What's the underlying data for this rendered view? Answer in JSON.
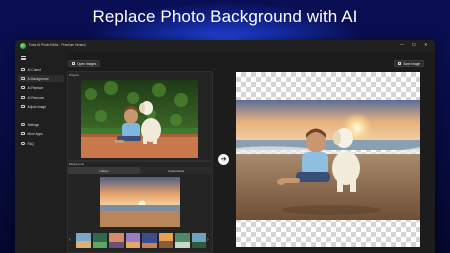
{
  "headline": "Replace Photo Background with AI",
  "window": {
    "title": "Fotor AI Photo Editor - Premium Version",
    "controls": [
      "—",
      "☐",
      "✕"
    ]
  },
  "sidebar": {
    "items": [
      {
        "label": "AI Cutout",
        "icon": "cutout-icon"
      },
      {
        "label": "AI Background",
        "icon": "background-icon"
      },
      {
        "label": "AI Replace",
        "icon": "replace-icon"
      },
      {
        "label": "AI Remover",
        "icon": "eraser-icon"
      },
      {
        "label": "Adjust Image",
        "icon": "adjust-icon"
      },
      {
        "label": "Settings",
        "icon": "gear-icon"
      },
      {
        "label": "More Apps",
        "icon": "apps-icon"
      },
      {
        "label": "FAQ",
        "icon": "help-icon"
      }
    ],
    "active_index": 1
  },
  "toolbar": {
    "open_label": "Open Images",
    "save_label": "Save Image"
  },
  "original": {
    "label": "Original"
  },
  "background": {
    "label": "Background",
    "tabs": [
      "Library",
      "Customized"
    ],
    "active_tab": 0,
    "prev": "‹",
    "next": "›"
  },
  "arrow": "➔",
  "colors": {
    "page_bg": "#070b3e",
    "window_bg": "#1c1c1c",
    "accent": "#2a48e0"
  }
}
